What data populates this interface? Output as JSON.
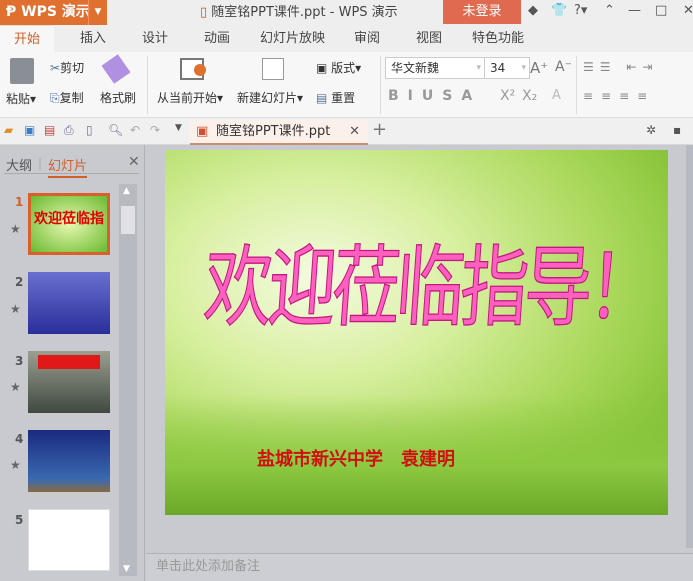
{
  "app": {
    "name": "WPS 演示",
    "title": "随室铭PPT课件.ppt - WPS 演示",
    "login": "未登录"
  },
  "tabs": [
    "开始",
    "插入",
    "设计",
    "动画",
    "幻灯片放映",
    "审阅",
    "视图",
    "特色功能"
  ],
  "ribbon": {
    "paste": "粘贴",
    "cut": "剪切",
    "copy": "复制",
    "format_painter": "格式刷",
    "from_current": "从当前开始",
    "new_slide": "新建幻灯片",
    "layout": "版式",
    "reset": "重置",
    "font": "华文新魏",
    "font_size": "34"
  },
  "doc_tab": "随室铭PPT课件.ppt",
  "panel": {
    "outline": "大纲",
    "slides": "幻灯片",
    "numbers": [
      "1",
      "2",
      "3",
      "4",
      "5"
    ]
  },
  "slide": {
    "title": "欢迎莅临指导！",
    "author": "盐城市新兴中学　袁建明"
  },
  "notes_placeholder": "单击此处添加备注"
}
